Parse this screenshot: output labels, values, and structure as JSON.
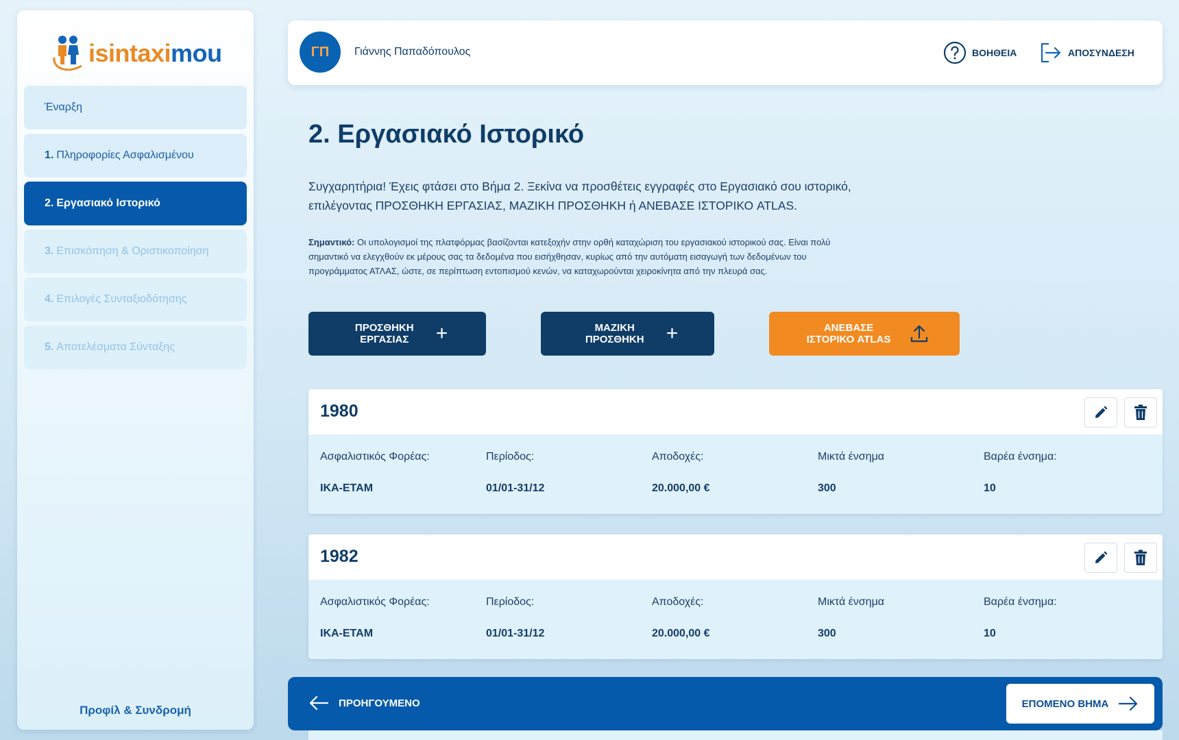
{
  "brand": {
    "logo_text_a": "isintaxi",
    "logo_text_b": "mou"
  },
  "sidebar": {
    "items": [
      {
        "num": "",
        "label": "Έναρξη",
        "state": "normal"
      },
      {
        "num": "1.",
        "label": "Πληροφορίες Ασφαλισμένου",
        "state": "normal"
      },
      {
        "num": "2.",
        "label": "Εργασιακό Ιστορικό",
        "state": "active"
      },
      {
        "num": "3.",
        "label": "Επισκόπηση & Οριστικοποίηση",
        "state": "disabled"
      },
      {
        "num": "4.",
        "label": "Επιλογές Συνταξιοδότησης",
        "state": "disabled"
      },
      {
        "num": "5.",
        "label": "Αποτελέσματα Σύνταξης",
        "state": "disabled"
      }
    ],
    "profile_link": "Προφίλ & Συνδρομή"
  },
  "header": {
    "avatar_initials": "ΓΠ",
    "user_name": "Γιάννης Παπαδόπουλος",
    "help_label": "ΒΟΗΘΕΙΑ",
    "logout_label": "ΑΠΟΣΥΝΔΕΣΗ"
  },
  "main": {
    "title": "2. Εργασιακό Ιστορικό",
    "intro": "Συγχαρητήρια! Έχεις φτάσει στο Βήμα 2. Ξεκίνα να προσθέτεις εγγραφές στο Εργασιακό σου ιστορικό, επιλέγοντας ΠΡΟΣΘΗΚΗ ΕΡΓΑΣΙΑΣ, ΜΑΖΙΚΗ ΠΡΟΣΘΗΚΗ ή ΑΝΕΒΑΣΕ ΙΣΤΟΡΙΚΟ ATLAS.",
    "note_label": "Σημαντικό:",
    "note_text": "Οι υπολογισμοί της πλατφόρμας βασίζονται κατεξοχήν στην ορθή καταχώριση του εργασιακού ιστορικού σας. Είναι πολύ σημαντικό να ελεγχθούν εκ μέρους σας τα δεδομένα που εισήχθησαν, κυρίως από την αυτόματη εισαγωγή των δεδομένων του προγράμματος ΑΤΛΑΣ, ώστε, σε περίπτωση εντοπισμού κενών, να καταχωρούνται χειροκίνητα από την πλευρά σας.",
    "actions": {
      "add_work": "ΠΡΟΣΘΗΚΗ ΕΡΓΑΣΙΑΣ",
      "bulk_add": "ΜΑΖΙΚΗ ΠΡΟΣΘΗΚΗ",
      "upload_atlas": "ΑΝΕΒΑΣΕ ΙΣΤΟΡΙΚΟ ATLAS"
    },
    "field_labels": {
      "fund": "Ασφαλιστικός Φορέας:",
      "period": "Περίοδος:",
      "earnings": "Αποδοχές:",
      "mixed": "Μικτά ένσημα",
      "heavy": "Βαρέα ένσημα:"
    },
    "records": [
      {
        "year": "1980",
        "fund": "ΙΚΑ-ΕΤΑΜ",
        "period": "01/01-31/12",
        "earnings": "20.000,00 €",
        "mixed": "300",
        "heavy": "10"
      },
      {
        "year": "1982",
        "fund": "ΙΚΑ-ΕΤΑΜ",
        "period": "01/01-31/12",
        "earnings": "20.000,00 €",
        "mixed": "300",
        "heavy": "10"
      }
    ]
  },
  "footer": {
    "prev_label": "ΠΡΟΗΓΟΥΜΕΝΟ",
    "next_label": "ΕΠΟΜΕΝΟ ΒΗΜΑ"
  },
  "colors": {
    "primary": "#075aab",
    "navy": "#0f3d68",
    "accent": "#f28a22"
  }
}
